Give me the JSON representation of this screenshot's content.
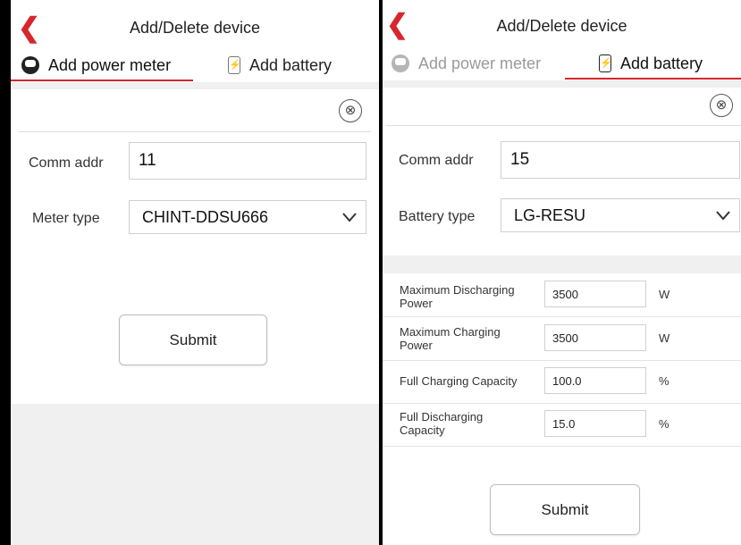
{
  "left": {
    "title": "Add/Delete device",
    "tabs": [
      {
        "label": "Add power meter",
        "active": true
      },
      {
        "label": "Add battery",
        "active": false
      }
    ],
    "close_icon": "⊗",
    "comm_addr_label": "Comm addr",
    "comm_addr_value": "11",
    "meter_type_label": "Meter type",
    "meter_type_value": "CHINT-DDSU666",
    "submit_label": "Submit"
  },
  "right": {
    "title": "Add/Delete device",
    "tabs": [
      {
        "label": "Add power meter",
        "active": false
      },
      {
        "label": "Add battery",
        "active": true
      }
    ],
    "close_icon": "⊗",
    "comm_addr_label": "Comm addr",
    "comm_addr_value": "15",
    "battery_type_label": "Battery type",
    "battery_type_value": "LG-RESU",
    "params": [
      {
        "label": "Maximum Discharging Power",
        "value": "3500",
        "unit": "W"
      },
      {
        "label": "Maximum Charging Power",
        "value": "3500",
        "unit": "W"
      },
      {
        "label": "Full Charging Capacity",
        "value": "100.0",
        "unit": "%"
      },
      {
        "label": "Full Discharging Capacity",
        "value": "15.0",
        "unit": "%"
      }
    ],
    "submit_label": "Submit"
  },
  "colors": {
    "accent": "#d7262c",
    "divider": "#dcdcdc",
    "gray_bg": "#f0f0f0"
  },
  "icons": {
    "back": "back-arrow-icon",
    "meter": "power-meter-icon",
    "battery": "battery-icon",
    "close": "close-circle-icon",
    "dropdown": "chevron-down-icon"
  }
}
